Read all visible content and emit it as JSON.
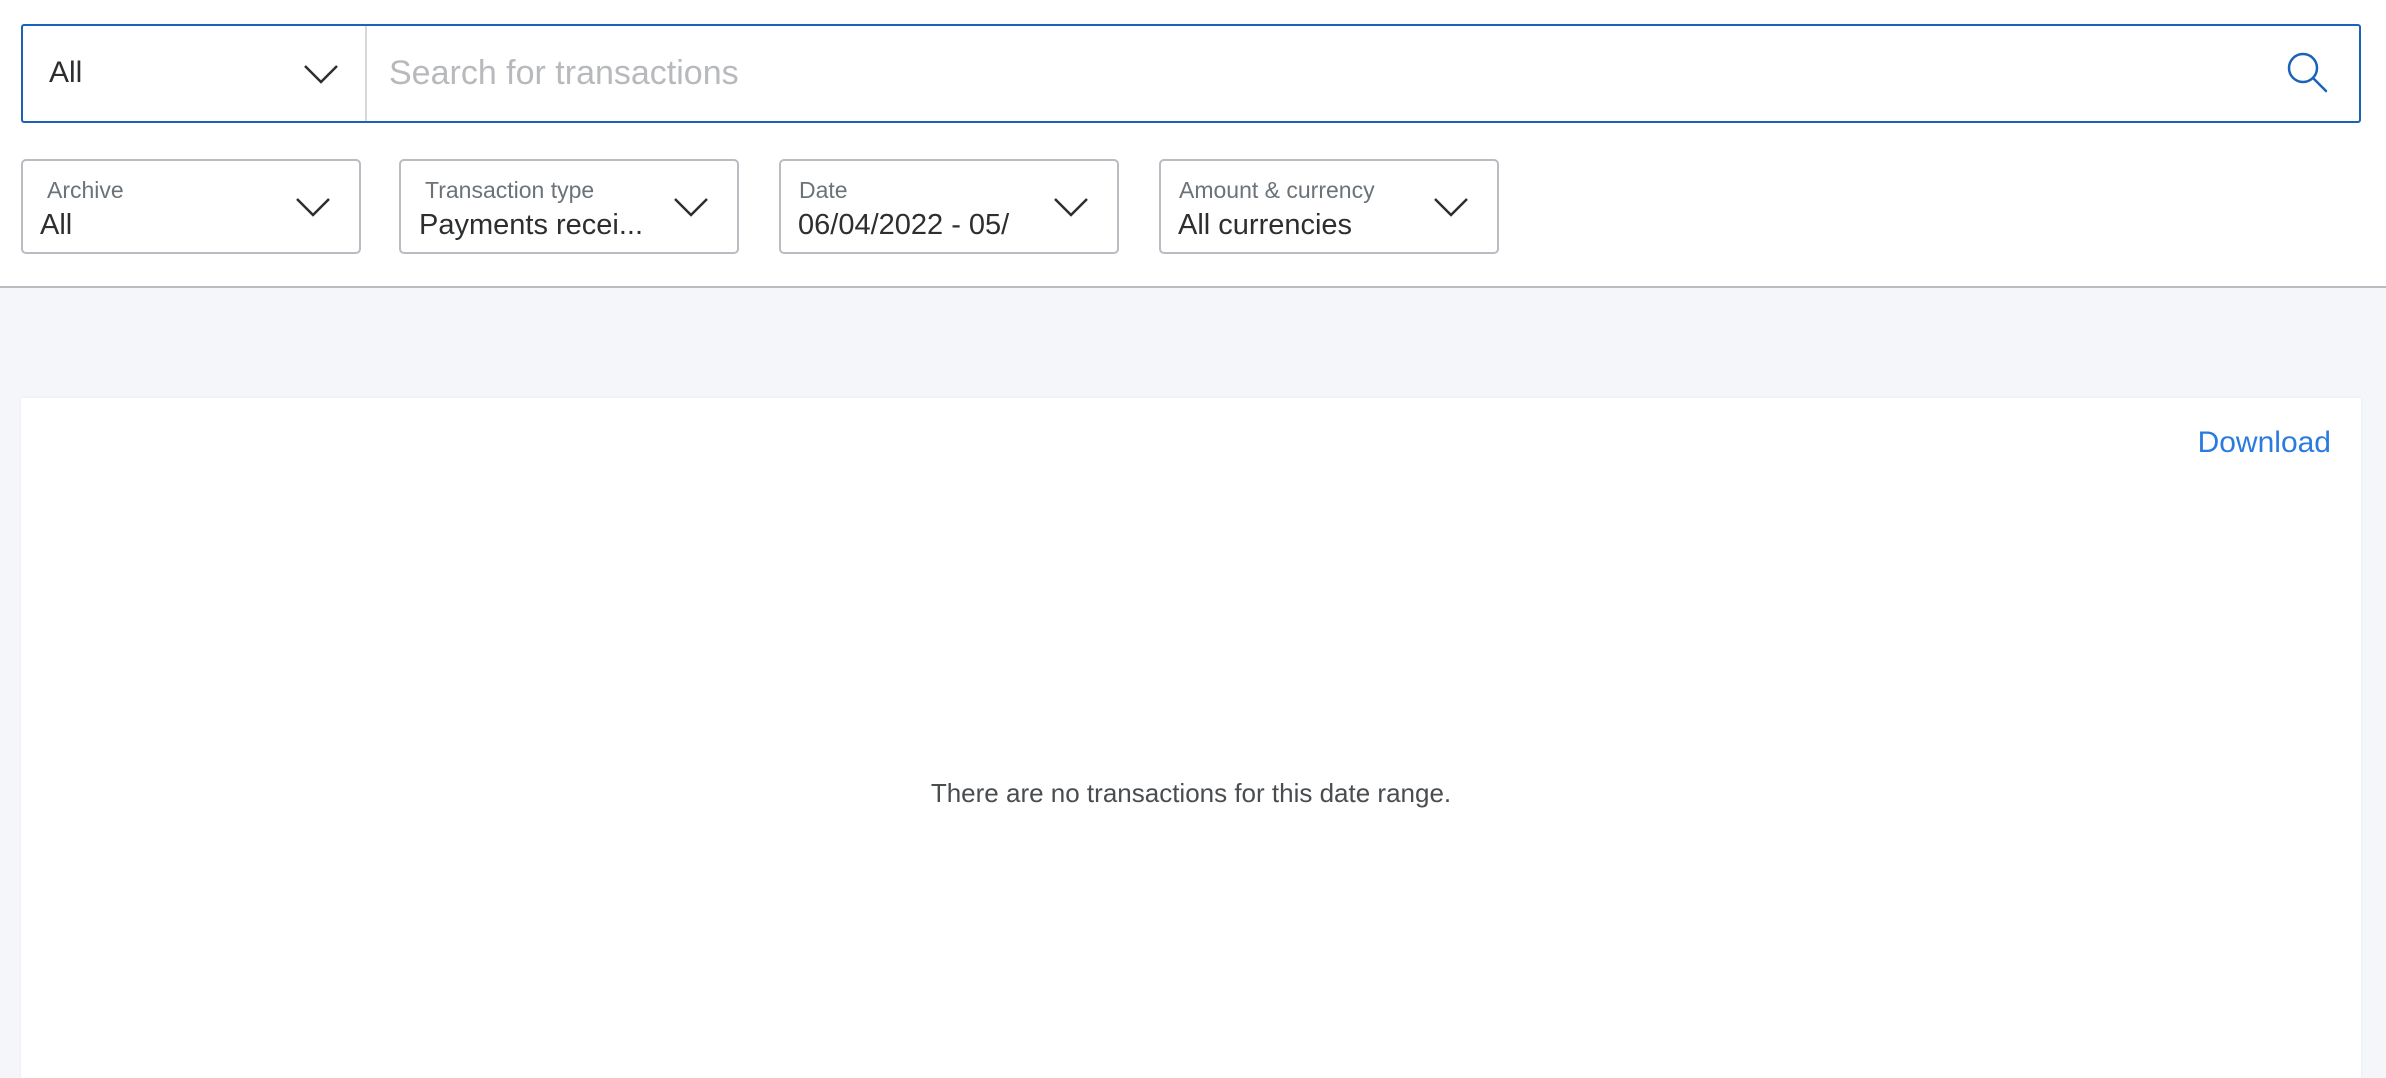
{
  "search": {
    "scope_value": "All",
    "placeholder": "Search for transactions",
    "value": ""
  },
  "filters": {
    "archive": {
      "label": "Archive",
      "value": "All"
    },
    "transaction_type": {
      "label": "Transaction type",
      "value": "Payments recei..."
    },
    "date": {
      "label": "Date",
      "value": "06/04/2022 - 05/"
    },
    "amount_currency": {
      "label": "Amount & currency",
      "value": "All currencies"
    }
  },
  "results": {
    "download_label": "Download",
    "empty_message": "There are no transactions for this date range."
  },
  "icons": {
    "search": "search-icon",
    "dropdown": "chevron-down-icon"
  },
  "colors": {
    "accent": "#1a63b8",
    "link": "#2a7be0",
    "page_background": "#f5f6f9"
  }
}
